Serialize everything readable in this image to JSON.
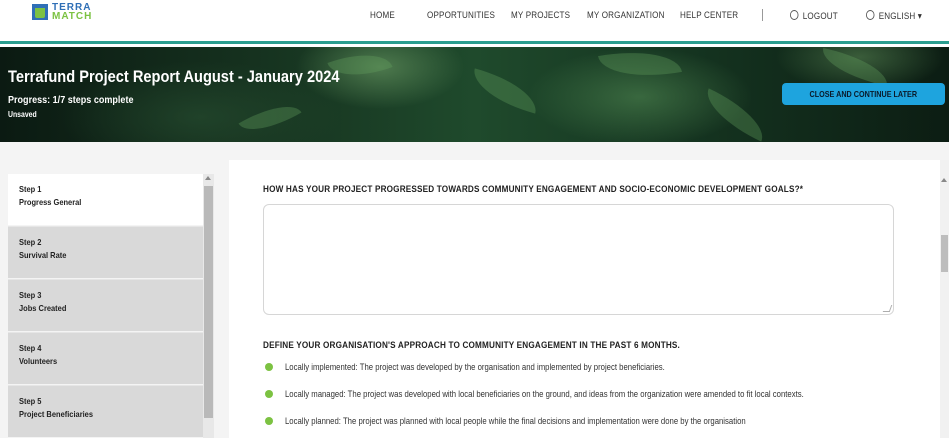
{
  "brand": {
    "line1": "TERRA",
    "line2": "MATCH"
  },
  "nav": {
    "home": "HOME",
    "opportunities": "OPPORTUNITIES",
    "my_projects": "MY PROJECTS",
    "my_organization": "MY ORGANIZATION",
    "help_center": "HELP CENTER",
    "logout": "LOGOUT",
    "language": "ENGLISH ▾"
  },
  "header": {
    "title": "Terrafund Project Report August - January 2024",
    "progress": "Progress: 1/7 steps complete",
    "save_status": "Unsaved",
    "close_button": "CLOSE AND CONTINUE LATER"
  },
  "steps": [
    {
      "num": "Step 1",
      "name": "Progress General",
      "active": true
    },
    {
      "num": "Step 2",
      "name": "Survival Rate",
      "active": false
    },
    {
      "num": "Step 3",
      "name": "Jobs Created",
      "active": false
    },
    {
      "num": "Step 4",
      "name": "Volunteers",
      "active": false
    },
    {
      "num": "Step 5",
      "name": "Project Beneficiaries",
      "active": false
    }
  ],
  "form": {
    "question1": "HOW HAS YOUR PROJECT PROGRESSED TOWARDS COMMUNITY ENGAGEMENT AND SOCIO-ECONOMIC DEVELOPMENT GOALS?*",
    "answer1": "",
    "question2": "DEFINE YOUR ORGANISATION'S APPROACH TO COMMUNITY ENGAGEMENT IN THE PAST 6 MONTHS.",
    "options": [
      "Locally implemented: The project was developed by the organisation and implemented by project beneficiaries.",
      "Locally managed: The project was developed with local beneficiaries on the ground, and ideas from the organization were amended to fit local contexts.",
      "Locally planned: The project was planned with local people while the final decisions and implementation were done by the organisation"
    ]
  },
  "colors": {
    "accent": "#1ea4de",
    "bullet": "#7cc242",
    "brand_blue": "#2f6fb6",
    "nav_border": "#2a9d8f"
  }
}
